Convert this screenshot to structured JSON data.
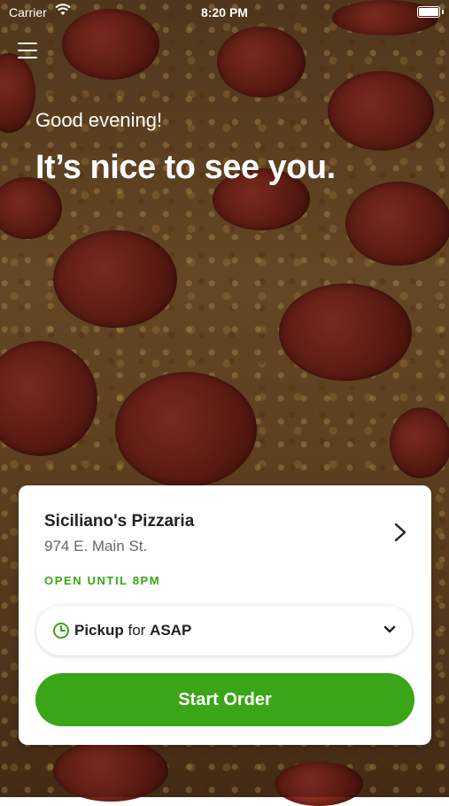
{
  "status_bar": {
    "carrier": "Carrier",
    "time": "8:20 PM"
  },
  "header": {
    "menu_icon": "hamburger-menu-icon"
  },
  "greeting": {
    "small": "Good evening!",
    "large": "It’s nice to see you."
  },
  "store_card": {
    "name": "Siciliano's Pizzaria",
    "address": "974 E. Main St.",
    "status": "OPEN UNTIL 8PM",
    "order_mode": {
      "type": "Pickup",
      "connector": "for",
      "time": "ASAP"
    },
    "start_button_label": "Start Order"
  },
  "colors": {
    "accent_green": "#3aa517",
    "card_bg": "#ffffff"
  }
}
